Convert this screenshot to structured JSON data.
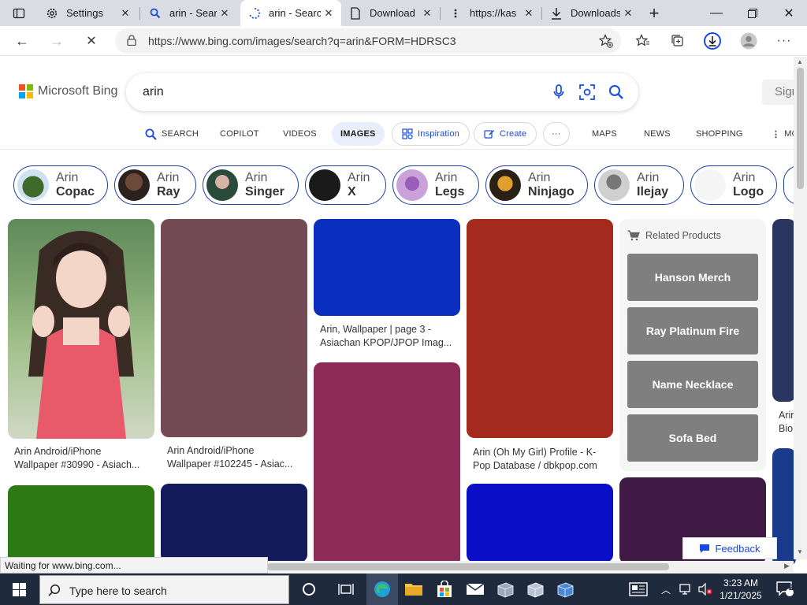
{
  "browser": {
    "tabs": [
      {
        "label": "Settings",
        "icon": "gear-icon"
      },
      {
        "label": "arin - Searc",
        "icon": "search-icon"
      },
      {
        "label": "arin - Searc",
        "icon": "loading-spinner-icon",
        "active": true
      },
      {
        "label": "Download",
        "icon": "document-icon"
      },
      {
        "label": "https://kas",
        "icon": "page-icon"
      },
      {
        "label": "Downloads",
        "icon": "download-icon"
      }
    ],
    "url": "https://www.bing.com/images/search?q=arin&FORM=HDRSC3"
  },
  "bing": {
    "logo_text": "Microsoft Bing",
    "query": "arin",
    "signin_label": "Sign",
    "nav": {
      "search": "SEARCH",
      "copilot": "COPILOT",
      "videos": "VIDEOS",
      "images": "IMAGES",
      "inspiration": "Inspiration",
      "create": "Create",
      "more_dots": "···",
      "maps": "MAPS",
      "news": "NEWS",
      "shopping": "SHOPPING",
      "more": "MO"
    },
    "chips": [
      {
        "name": "Arin",
        "term": "Copac"
      },
      {
        "name": "Arin",
        "term": "Ray"
      },
      {
        "name": "Arin",
        "term": "Singer"
      },
      {
        "name": "Arin",
        "term": "X"
      },
      {
        "name": "Arin",
        "term": "Legs"
      },
      {
        "name": "Arin",
        "term": "Ninjago"
      },
      {
        "name": "Arin",
        "term": "Ilejay"
      },
      {
        "name": "Arin",
        "term": "Logo"
      }
    ],
    "captions": {
      "c1_l1": "Arin Android/iPhone",
      "c1_l2": "Wallpaper #30990 - Asiach...",
      "c2_l1": "Arin Android/iPhone",
      "c2_l2": "Wallpaper #102245 - Asiac...",
      "c3_l1": "Arin, Wallpaper | page 3 -",
      "c3_l2": "Asiachan KPOP/JPOP Imag...",
      "c4_l1": "Arin (Oh My Girl) Profile - K-",
      "c4_l2": "Pop Database / dbkpop.com",
      "c5_l1": "Arin",
      "c5_l2": "Bio"
    },
    "related_products": {
      "title": "Related Products",
      "items": [
        "Hanson Merch",
        "Ray Platinum Fire",
        "Name Necklace",
        "Sofa Bed"
      ]
    },
    "feedback_label": "Feedback",
    "status_text": "Waiting for www.bing.com..."
  },
  "taskbar": {
    "search_placeholder": "Type here to search",
    "time": "3:23 AM",
    "date": "1/21/2025",
    "notification_count": "2"
  },
  "colors": {
    "accent": "#174ae4",
    "img_mauve": "#744a55",
    "img_blue": "#0a2fbf",
    "img_red": "#a52a1e",
    "img_magenta": "#8e2a58",
    "img_green": "#2e7a12",
    "img_navy": "#141b5c",
    "img_royal": "#0a0fc7",
    "img_plum": "#3e1a45",
    "taskbar": "#1f2a3c"
  }
}
